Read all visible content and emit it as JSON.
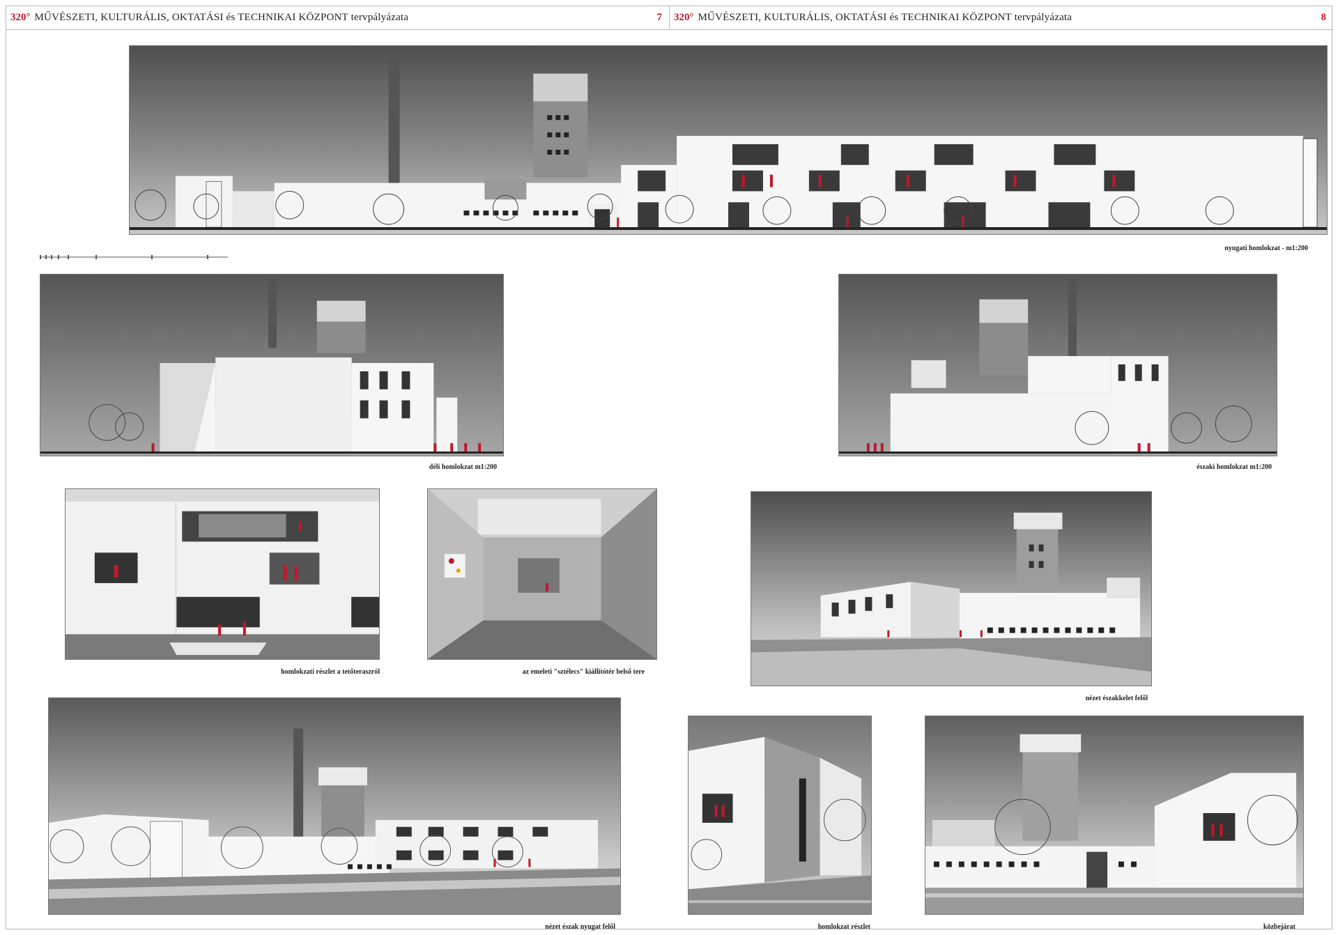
{
  "header": {
    "left": {
      "number": "320°",
      "title": "MŰVÉSZETI, KULTURÁLIS, OKTATÁSI és TECHNIKAI KÖZPONT tervpályázata",
      "page": "7"
    },
    "right": {
      "number": "320°",
      "title": "MŰVÉSZETI, KULTURÁLIS, OKTATÁSI és TECHNIKAI KÖZPONT tervpályázata",
      "page": "8"
    }
  },
  "captions": {
    "west_elevation": "nyugati homlokzat - m1:200",
    "south_elevation": "déli homlokzat m1:200",
    "north_elevation": "északi homlokzat m1:200",
    "facade_detail": "homlokzati részlet a tetőteraszról",
    "gallery_interior": "az emeleti \"sztélecs\" kiállítótér belső tere",
    "northeast_view": "nézet északkelet felől",
    "northwest_view": "nézet észak nyugat felől",
    "facade_detail_2": "homlokzat részlet",
    "street_view": "közbejárat"
  },
  "colors": {
    "accent_red": "#c0182c",
    "sky_dark": "#5a5a5a",
    "building_white": "#f4f4f4"
  }
}
